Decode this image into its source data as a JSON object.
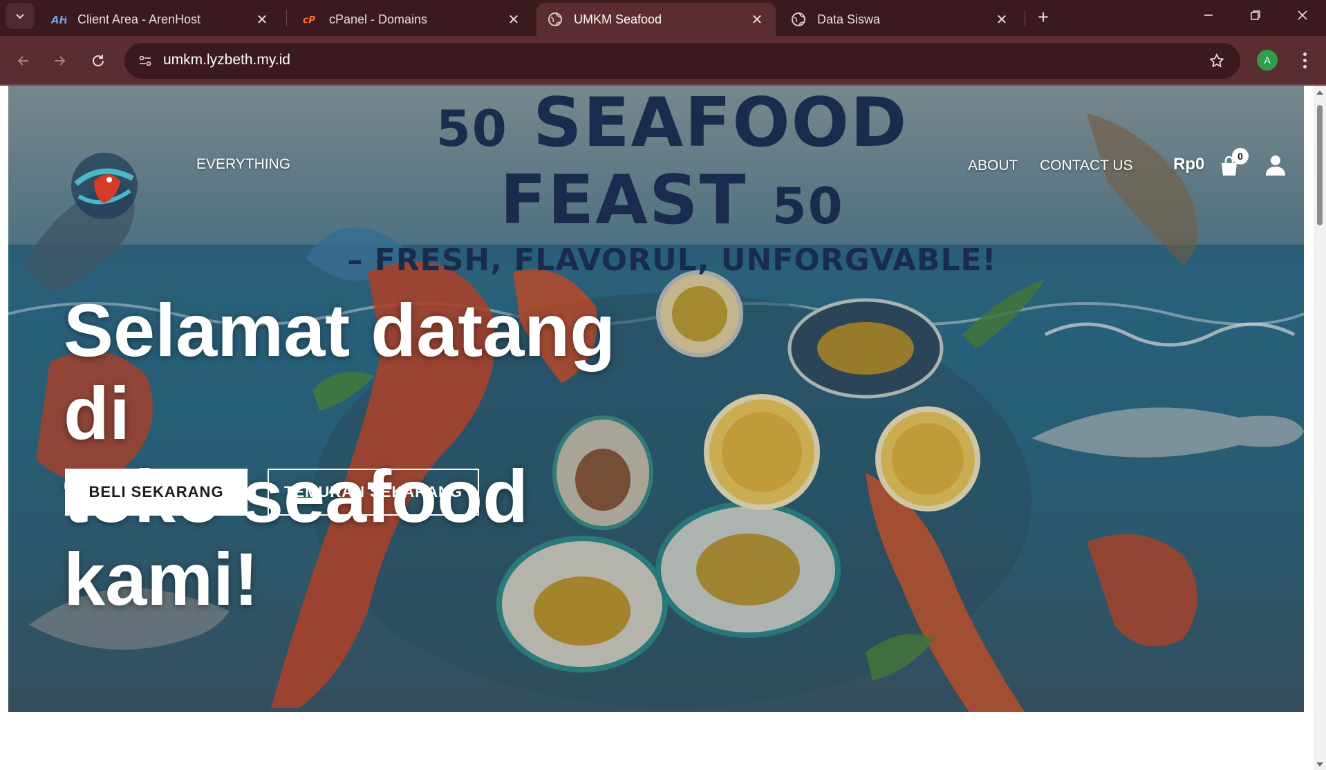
{
  "browser": {
    "tabs": [
      {
        "title": "Client Area - ArenHost",
        "favicon": "arenhost-icon",
        "active": false
      },
      {
        "title": "cPanel - Domains",
        "favicon": "cpanel-icon",
        "active": false
      },
      {
        "title": "UMKM Seafood",
        "favicon": "globe-icon",
        "active": true
      },
      {
        "title": "Data Siswa",
        "favicon": "globe-icon",
        "active": false
      }
    ],
    "new_tab": "+",
    "url": "umkm.lyzbeth.my.id",
    "profile_initial": "A"
  },
  "site": {
    "nav_left": "EVERYTHING",
    "nav_about": "ABOUT",
    "nav_contact": "CONTACT US",
    "cart_total": "Rp0",
    "cart_count": "0"
  },
  "poster": {
    "number_left": "50",
    "headline": "SEAFOOD FEAST",
    "number_right": "50",
    "subline": "– FRESH, FLAVORUL, UNFORGVABLE!"
  },
  "hero": {
    "heading_line1": "Selamat datang di",
    "heading_line2": "toko seafood kami!",
    "button_primary": "BELI SEKARANG",
    "button_secondary": "TEMUKAN SEKARANG"
  },
  "colors": {
    "chrome_dark": "#3a1a1e",
    "chrome_toolbar": "#5a2d33",
    "poster_title": "#1a2c4e",
    "hero_blue": "#2f6f8c"
  }
}
